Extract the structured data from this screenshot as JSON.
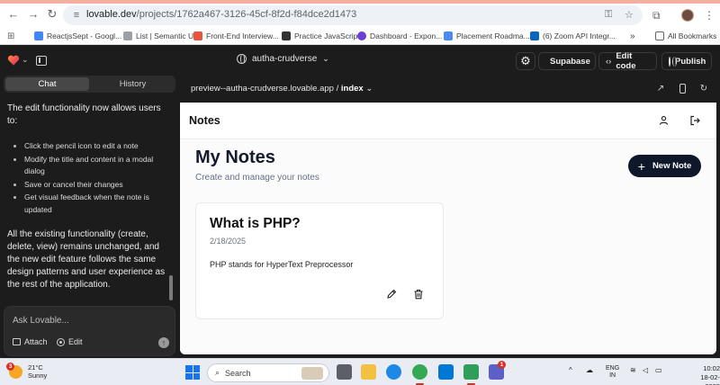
{
  "browser": {
    "url_host": "lovable.dev",
    "url_path": "/projects/1762a467-3126-45cf-8f2d-f84dce2d1473",
    "bookmarks": [
      {
        "label": "ReactjsSept - Googl...",
        "color": "#4285f4"
      },
      {
        "label": "List | Semantic UI",
        "color": "#9aa0a6"
      },
      {
        "label": "Front-End Interview...",
        "color": "#e8543f"
      },
      {
        "label": "Practice JavaScript",
        "color": "#333333"
      },
      {
        "label": "Dashboard - Expon...",
        "color": "#6b3fd6"
      },
      {
        "label": "Placement Roadma...",
        "color": "#4a8af4"
      },
      {
        "label": "(6) Zoom API Integr...",
        "color": "#0a66c2"
      }
    ],
    "more_label": "»",
    "all_bookmarks": "All Bookmarks"
  },
  "topbar": {
    "project_name": "autha-crudverse",
    "supabase_label": "Supabase",
    "edit_code_label": "Edit code",
    "publish_label": "Publish"
  },
  "chat": {
    "tabs": [
      {
        "label": "Chat"
      },
      {
        "label": "History"
      }
    ],
    "intro": "The edit functionality now allows users to:",
    "bullets": [
      "Click the pencil icon to edit a note",
      "Modify the title and content in a modal dialog",
      "Save or cancel their changes",
      "Get visual feedback when the note is updated"
    ],
    "outro": "All the existing functionality (create, delete, view) remains unchanged, and the new edit feature follows the same design patterns and user experience as the rest of the application.",
    "input_placeholder": "Ask Lovable...",
    "attach_label": "Attach",
    "edit_label": "Edit"
  },
  "preview": {
    "url": "preview--autha-crudverse.lovable.app",
    "separator": " / ",
    "page": "index"
  },
  "app": {
    "header_title": "Notes",
    "heading": "My Notes",
    "subheading": "Create and manage your notes",
    "new_note_label": "New Note",
    "notes": [
      {
        "title": "What is PHP?",
        "date": "2/18/2025",
        "content": "PHP stands for HyperText Preprocessor"
      }
    ]
  },
  "taskbar": {
    "temperature": "21°C",
    "condition": "Sunny",
    "weather_badge": "3",
    "search_placeholder": "Search",
    "teams_badge": "1",
    "lang_1": "ENG",
    "lang_2": "IN",
    "time": "10:02",
    "date": "18-02-2025"
  },
  "colors": {
    "accent_dark": "#0f172a",
    "supabase_green": "#3ecf8e"
  }
}
